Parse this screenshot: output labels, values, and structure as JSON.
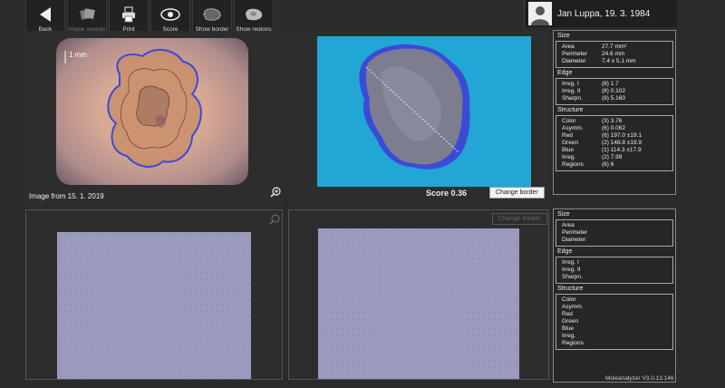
{
  "toolbar": {
    "buttons": [
      {
        "label": "Back",
        "icon": "back-arrow-icon",
        "enabled": true
      },
      {
        "label": "Image overlay",
        "icon": "image-overlay-icon",
        "enabled": false
      },
      {
        "label": "Print",
        "icon": "printer-icon",
        "enabled": true
      },
      {
        "label": "Score",
        "icon": "eye-icon",
        "enabled": true
      },
      {
        "label": "Show border",
        "icon": "border-icon",
        "enabled": true
      },
      {
        "label": "Show regions",
        "icon": "regions-icon",
        "enabled": true
      }
    ]
  },
  "patient": {
    "name": "Jan Luppa, 19. 3. 1984"
  },
  "top_left": {
    "scale_label": "1 mm",
    "caption": "Image from 15. 1. 2019"
  },
  "top_right": {
    "score_text": "Score  0.36",
    "change_border": "Change border"
  },
  "bottom_right": {
    "change_border": "Change border"
  },
  "stats_top": {
    "size_title": "Size",
    "size": [
      {
        "k": "Area",
        "v": "27.7 mm²"
      },
      {
        "k": "Perimeter",
        "v": "24.6 mm"
      },
      {
        "k": "Diameter",
        "v": "7.4 x 5.1 mm"
      }
    ],
    "edge_title": "Edge",
    "edge": [
      {
        "k": "Irreg. I",
        "v": "(8) 1.7"
      },
      {
        "k": "Irreg. II",
        "v": "(8) 0.102"
      },
      {
        "k": "Sharpn.",
        "v": "(8) 5.160"
      }
    ],
    "structure_title": "Structure",
    "structure": [
      {
        "k": "Color",
        "v": "(3) 3.76"
      },
      {
        "k": "Asymm.",
        "v": "(6) 0.062"
      },
      {
        "k": "Red",
        "v": "(6) 197.0  ±19.1"
      },
      {
        "k": "Green",
        "v": "(2) 148.8  ±19.9"
      },
      {
        "k": "Blue",
        "v": "(1) 114.3  ±17.9"
      },
      {
        "k": "Irreg.",
        "v": "(2) 7.99"
      },
      {
        "k": "Regions",
        "v": "(6) 6"
      }
    ]
  },
  "stats_bottom": {
    "size_title": "Size",
    "size": [
      "Area",
      "Perimeter",
      "Diameter"
    ],
    "edge_title": "Edge",
    "edge": [
      "Irreg. I",
      "Irreg. II",
      "Sharpn."
    ],
    "structure_title": "Structure",
    "structure": [
      "Color",
      "Asymm.",
      "Red",
      "Green",
      "Blue",
      "Irreg.",
      "Regions"
    ]
  },
  "version": "Moleanalyzer V3.0.13.146",
  "colors": {
    "segmentation_bg": "#21a6d6",
    "border_line": "#3b4bd6",
    "app_bg": "#2b2b2b"
  }
}
